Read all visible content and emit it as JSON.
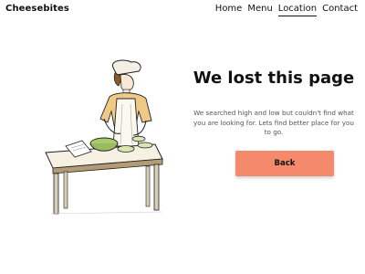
{
  "header": {
    "brand": "Cheesebites",
    "nav": [
      {
        "label": "Home",
        "active": false
      },
      {
        "label": "Menu",
        "active": false
      },
      {
        "label": "Location",
        "active": true
      },
      {
        "label": "Contact",
        "active": false
      }
    ]
  },
  "main": {
    "title": "We lost this page",
    "message": "We searched high and low but couldn't find what you are looking for. Lets find better place for you to go.",
    "back_label": "Back"
  },
  "colors": {
    "accent": "#f4896b",
    "text": "#111111",
    "muted": "#555555"
  }
}
